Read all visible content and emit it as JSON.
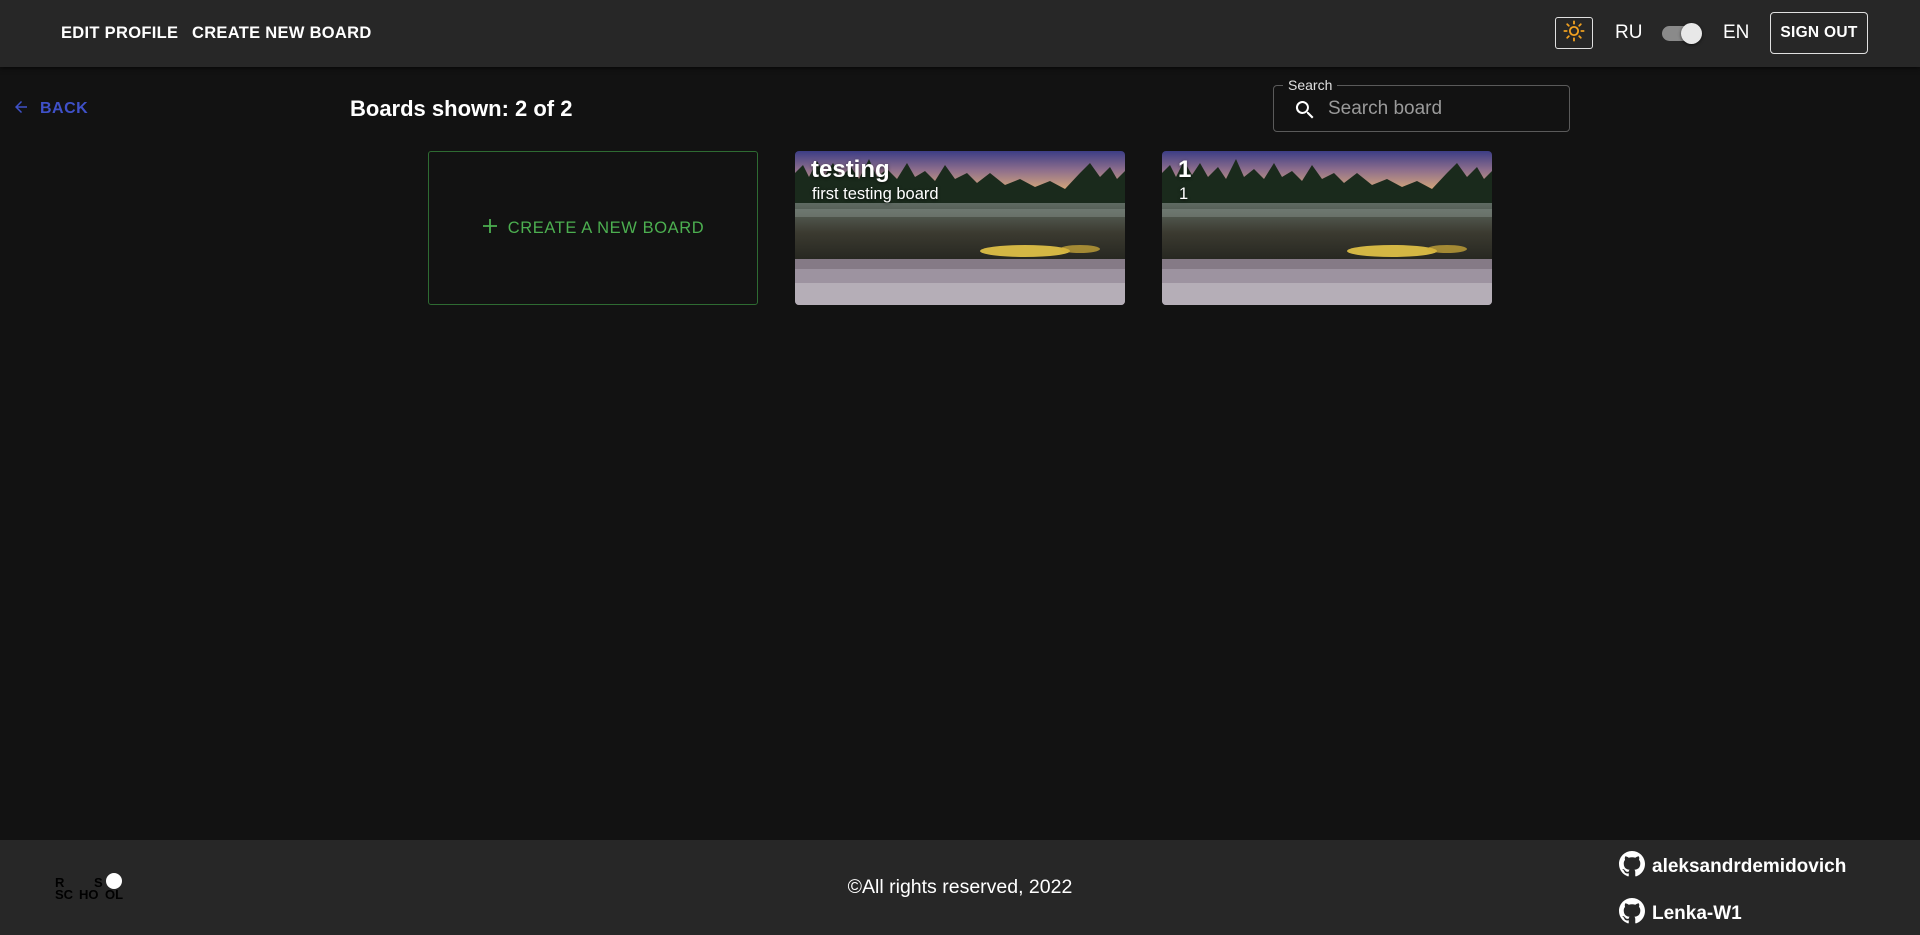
{
  "header": {
    "nav": {
      "edit_profile": "EDIT PROFILE",
      "create_new_board": "CREATE NEW BOARD"
    },
    "theme_icon": "sun-icon",
    "lang_left": "RU",
    "lang_right": "EN",
    "lang_toggle_on": true,
    "sign_out": "SIGN OUT"
  },
  "main": {
    "back": "BACK",
    "boards_shown": "Boards shown: 2 of 2",
    "search": {
      "label": "Search",
      "placeholder": "Search board",
      "value": ""
    },
    "create_card_label": "CREATE A NEW BOARD",
    "boards": [
      {
        "title": "testing",
        "description": "first testing board"
      },
      {
        "title": "1",
        "description": "1"
      }
    ]
  },
  "footer": {
    "logo_letters": [
      "R",
      "S",
      "SC",
      "HO",
      "OL"
    ],
    "copyright": "©All rights reserved, 2022",
    "authors": [
      "aleksandrdemidovich",
      "Lenka-W1"
    ]
  },
  "colors": {
    "background": "#121212",
    "header": "#272727",
    "back_link": "#3f51c8",
    "create_card": "#4caf50",
    "sun": "#f0a020"
  }
}
